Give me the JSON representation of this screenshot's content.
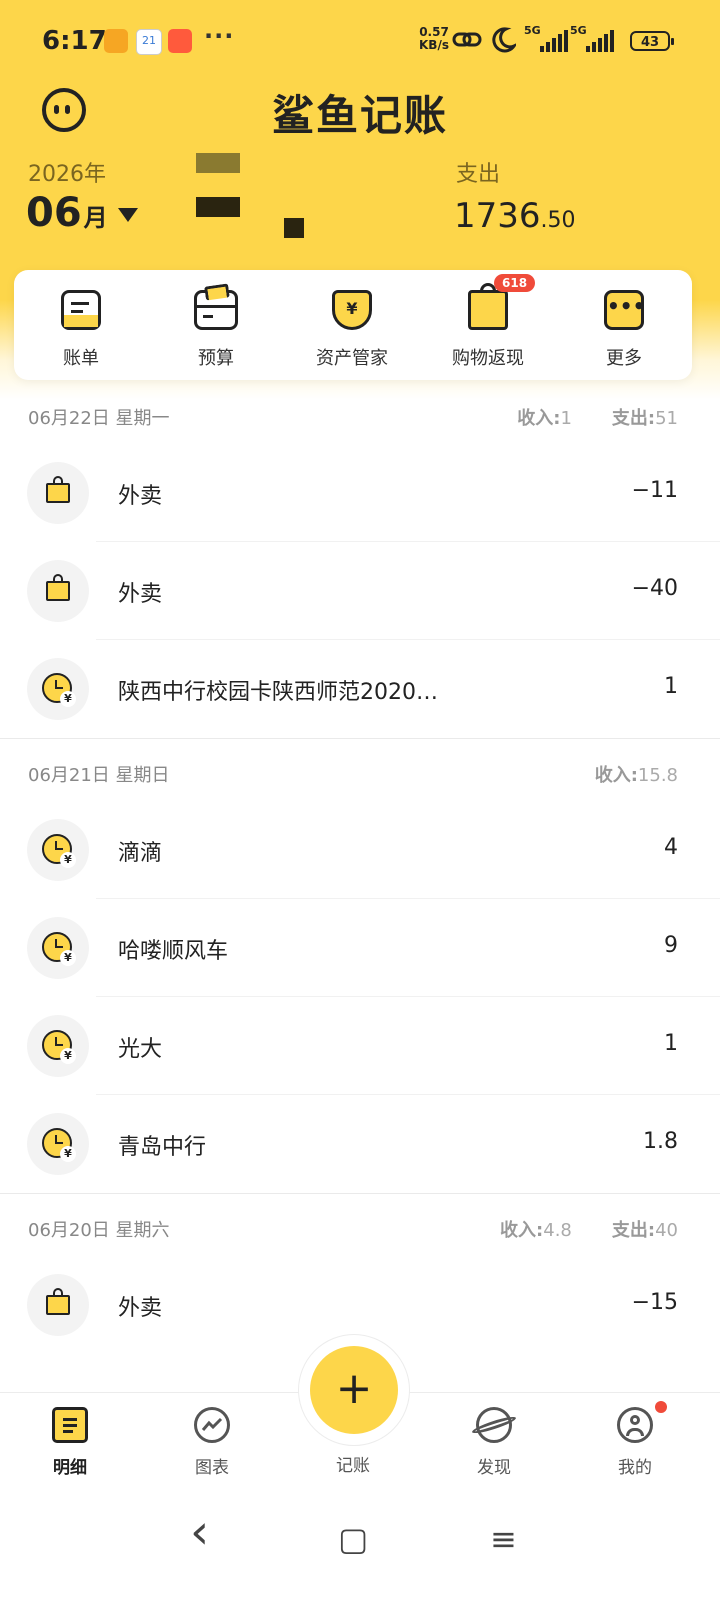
{
  "status_bar": {
    "time": "6:17",
    "dots": "···",
    "speed_value": "0.57",
    "speed_unit": "KB/s",
    "net1": "5G",
    "net2": "5G",
    "battery": "43"
  },
  "header": {
    "app_title": "鲨鱼记账",
    "year": "2026年",
    "month": "06",
    "month_unit": "月",
    "expense_label": "支出",
    "expense_int": "1736",
    "expense_dec": ".50"
  },
  "quick_actions": [
    {
      "label": "账单",
      "icon": "bill-icon"
    },
    {
      "label": "预算",
      "icon": "budget-wallet-icon"
    },
    {
      "label": "资产管家",
      "icon": "asset-shield-icon"
    },
    {
      "label": "购物返现",
      "icon": "shopping-bag-icon",
      "badge": "618"
    },
    {
      "label": "更多",
      "icon": "more-icon"
    }
  ],
  "days": [
    {
      "date": "06月22日 星期一",
      "income_label": "收入:",
      "income": "1",
      "expense_label": "支出:",
      "expense": "51",
      "items": [
        {
          "title": "外卖",
          "amount": "−11",
          "icon": "bag"
        },
        {
          "title": "外卖",
          "amount": "−40",
          "icon": "bag"
        },
        {
          "title": "陕西中行校园卡陕西师范2020…",
          "amount": "1",
          "icon": "clock"
        }
      ]
    },
    {
      "date": "06月21日 星期日",
      "income_label": "收入:",
      "income": "15.8",
      "items": [
        {
          "title": "滴滴",
          "amount": "4",
          "icon": "clock"
        },
        {
          "title": "哈喽顺风车",
          "amount": "9",
          "icon": "clock"
        },
        {
          "title": "光大",
          "amount": "1",
          "icon": "clock"
        },
        {
          "title": "青岛中行",
          "amount": "1.8",
          "icon": "clock"
        }
      ]
    },
    {
      "date": "06月20日 星期六",
      "income_label": "收入:",
      "income": "4.8",
      "expense_label": "支出:",
      "expense": "40",
      "items": [
        {
          "title": "外卖",
          "amount": "−15",
          "icon": "bag"
        }
      ]
    }
  ],
  "tabs": [
    {
      "label": "明细",
      "icon": "list-icon"
    },
    {
      "label": "图表",
      "icon": "chart-icon"
    },
    {
      "label": "记账",
      "icon": "plus-icon"
    },
    {
      "label": "发现",
      "icon": "planet-icon"
    },
    {
      "label": "我的",
      "icon": "profile-icon"
    }
  ],
  "fab_symbol": "+",
  "nav": {
    "back": "‹",
    "home": "▢",
    "menu": "≡"
  },
  "yen": "¥",
  "colors": {
    "brand_yellow": "#FDD64A",
    "badge_red": "#F04B3A",
    "text_dark": "#222222",
    "text_muted": "#888888"
  }
}
